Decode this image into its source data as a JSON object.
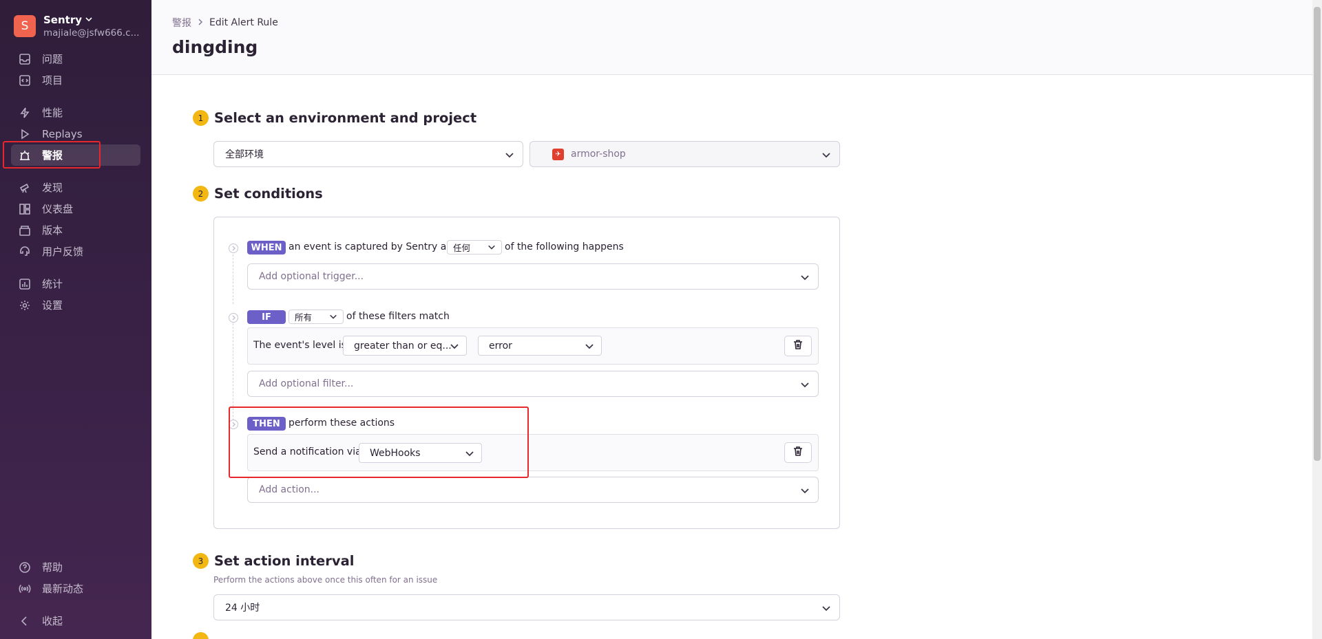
{
  "org": {
    "initial": "S",
    "name": "Sentry",
    "email": "majiale@jsfw666.c..."
  },
  "sidebar": {
    "items": [
      {
        "label": "问题",
        "icon": "inbox-icon"
      },
      {
        "label": "项目",
        "icon": "code-icon"
      },
      {
        "label": "性能",
        "icon": "lightning-icon"
      },
      {
        "label": "Replays",
        "icon": "play-icon"
      },
      {
        "label": "警报",
        "icon": "siren-icon",
        "active": true
      },
      {
        "label": "发现",
        "icon": "telescope-icon"
      },
      {
        "label": "仪表盘",
        "icon": "dashboard-icon"
      },
      {
        "label": "版本",
        "icon": "package-icon"
      },
      {
        "label": "用户反馈",
        "icon": "megaphone-icon"
      },
      {
        "label": "统计",
        "icon": "graph-icon"
      },
      {
        "label": "设置",
        "icon": "gear-icon"
      }
    ],
    "footer": [
      {
        "label": "帮助",
        "icon": "question-icon"
      },
      {
        "label": "最新动态",
        "icon": "broadcast-icon"
      },
      {
        "label": "收起",
        "icon": "chevron-left-icon"
      }
    ]
  },
  "header": {
    "breadcrumb": [
      "警报",
      "Edit Alert Rule"
    ],
    "title": "dingding"
  },
  "steps": {
    "s1": {
      "num": "1",
      "title": "Select an environment and project"
    },
    "s2": {
      "num": "2",
      "title": "Set conditions"
    },
    "s3": {
      "num": "3",
      "title": "Set action interval",
      "subtitle": "Perform the actions above once this often for an issue"
    }
  },
  "environment": {
    "value": "全部环境"
  },
  "project": {
    "value": "armor-shop"
  },
  "conditions": {
    "when": {
      "badge": "WHEN",
      "text_before": "an event is captured by Sentry and",
      "match": "任何",
      "text_after": "of the following happens",
      "add_placeholder": "Add optional trigger..."
    },
    "if": {
      "badge": "IF",
      "match": "所有",
      "text_after": "of these filters match",
      "filter_label": "The event's level is",
      "operator": "greater than or eq...",
      "level": "error",
      "add_placeholder": "Add optional filter..."
    },
    "then": {
      "badge": "THEN",
      "text_after": "perform these actions",
      "action_label": "Send a notification via",
      "service": "WebHooks",
      "add_placeholder": "Add action..."
    }
  },
  "interval": {
    "value": "24 小时"
  },
  "colors": {
    "accent": "#6c5fc7",
    "step": "#f2b712",
    "highlight": "#e8272c"
  }
}
